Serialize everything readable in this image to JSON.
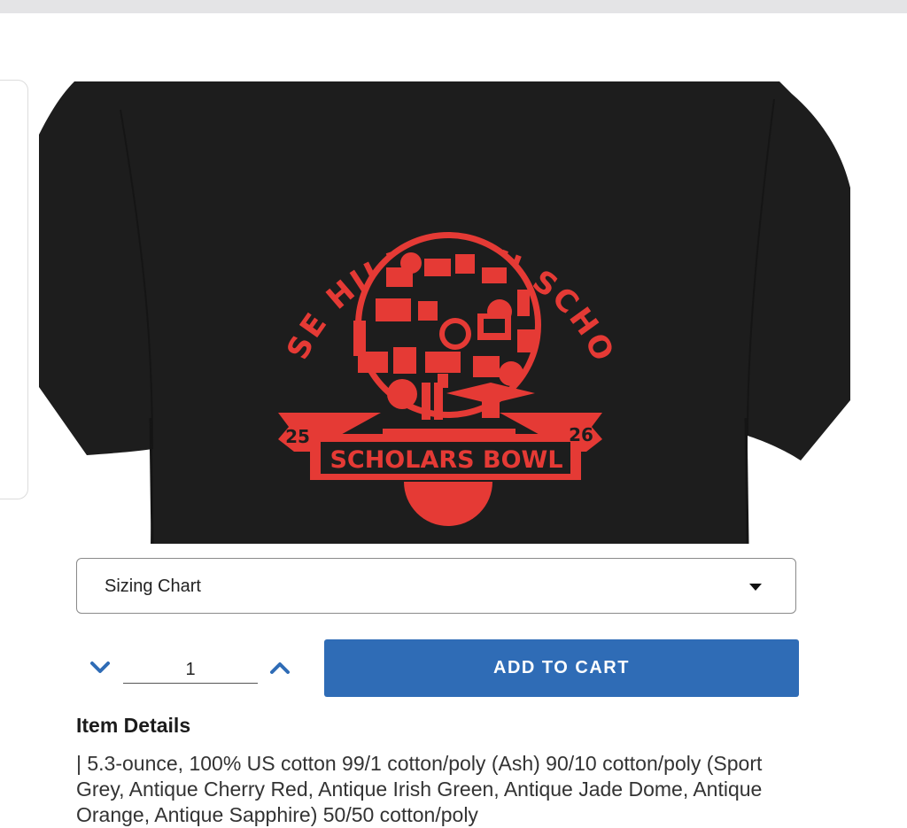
{
  "product": {
    "shirt_color": "#1d1d1d",
    "print_color": "#e53a35",
    "design": {
      "arc_text": "ROSE HILL HIGH SCHOOL",
      "year_left": "25",
      "year_right": "26",
      "banner_text": "SCHOLARS BOWL"
    }
  },
  "options": {
    "sizing_chart_label": "Sizing Chart"
  },
  "quantity": {
    "value": "1"
  },
  "cart": {
    "add_label": "ADD TO CART",
    "accent_color": "#2f6cb6"
  },
  "details": {
    "heading": "Item Details",
    "text": "| 5.3-ounce, 100% US cotton 99/1 cotton/poly (Ash) 90/10 cotton/poly (Sport Grey, Antique Cherry Red, Antique Irish Green, Antique Jade Dome, Antique Orange, Antique Sapphire) 50/50 cotton/poly"
  },
  "icons": [
    "chevron-down-icon",
    "chevron-up-icon",
    "caret-down-icon"
  ]
}
